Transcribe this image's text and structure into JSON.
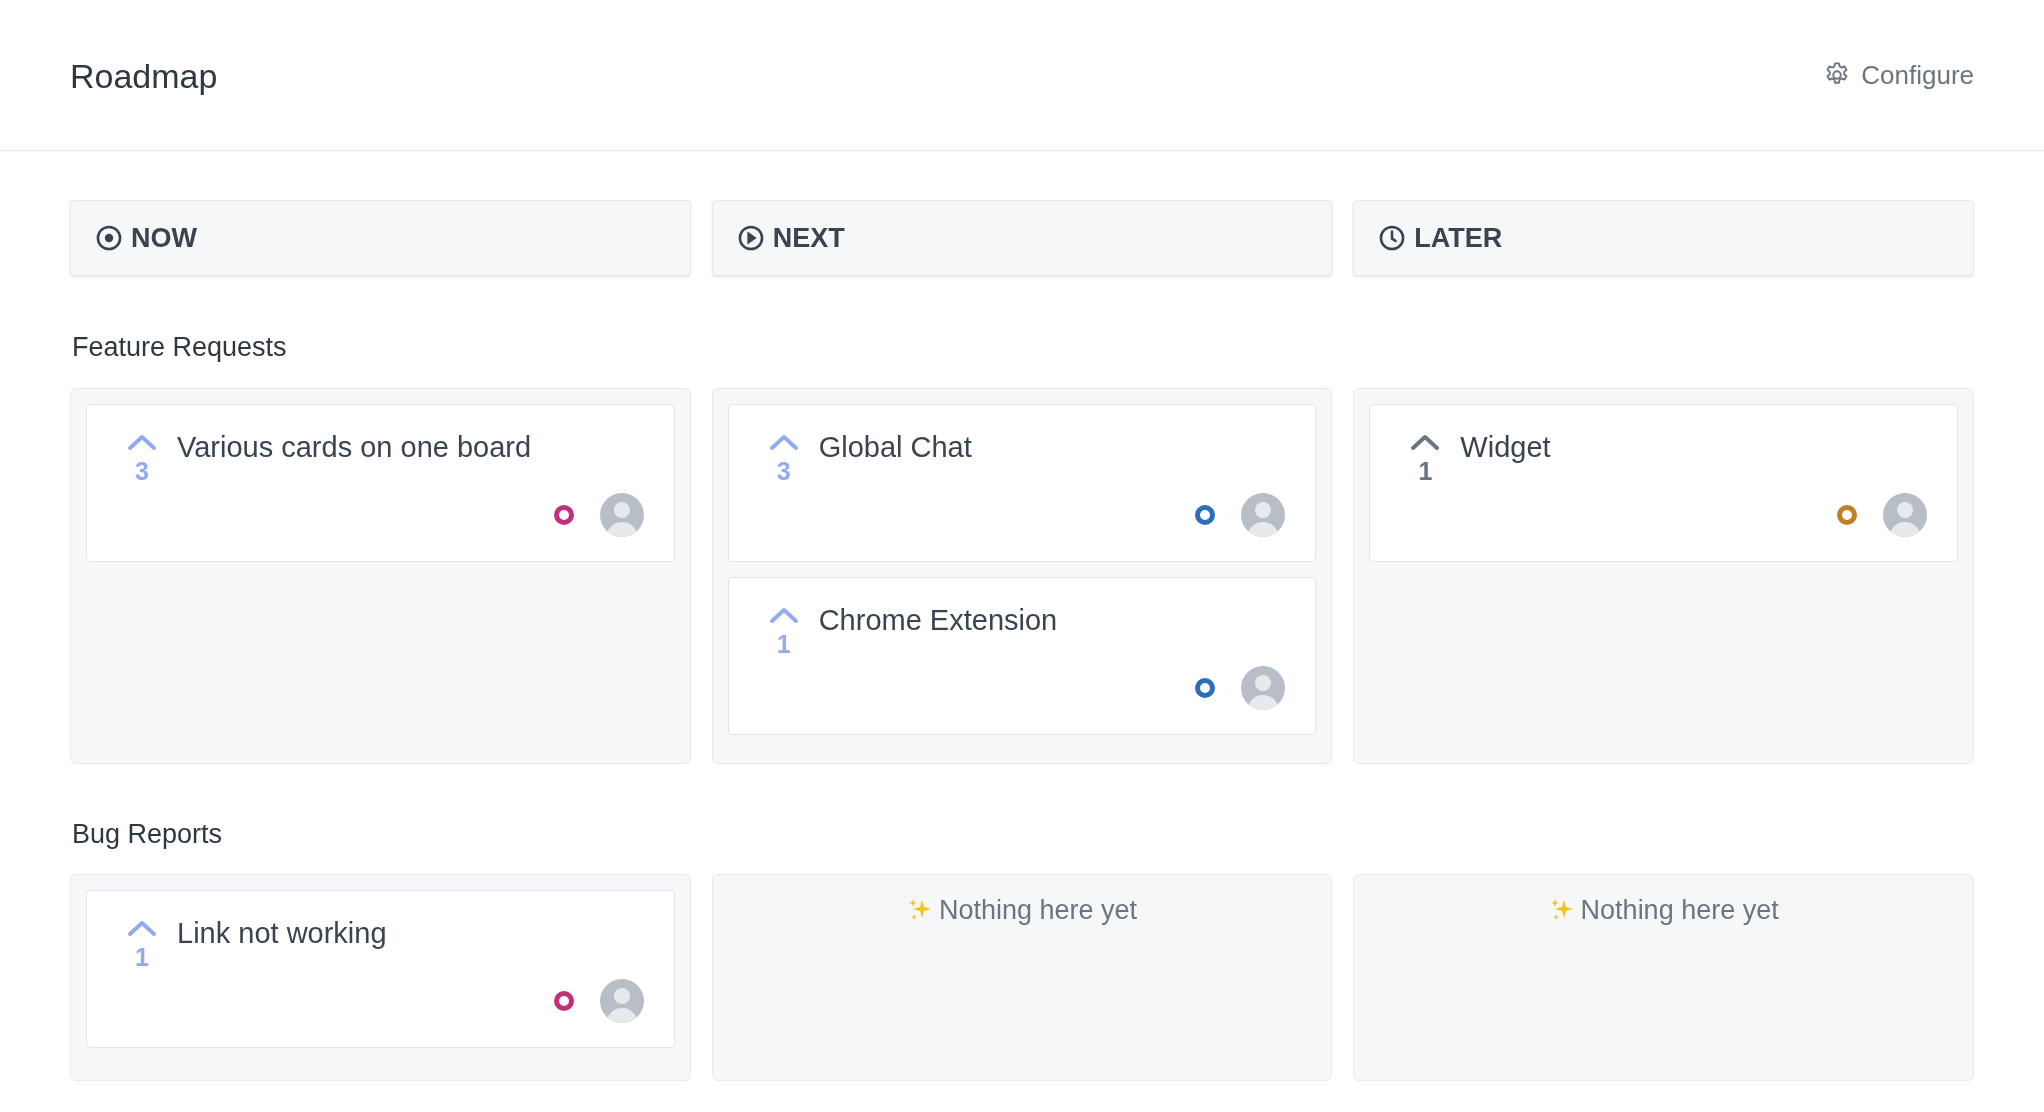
{
  "header": {
    "title": "Roadmap",
    "configure": "Configure"
  },
  "columns": [
    {
      "label": "NOW",
      "kind": "target"
    },
    {
      "label": "NEXT",
      "kind": "play"
    },
    {
      "label": "LATER",
      "kind": "clock"
    }
  ],
  "sections": [
    {
      "title": "Feature Requests",
      "lanes": [
        {
          "cards": [
            {
              "title": "Various cards on one board",
              "votes": "3",
              "voted": true,
              "color": "#c2307a"
            }
          ]
        },
        {
          "cards": [
            {
              "title": "Global Chat",
              "votes": "3",
              "voted": true,
              "color": "#2a6ebd"
            },
            {
              "title": "Chrome Extension",
              "votes": "1",
              "voted": true,
              "color": "#2a6ebd"
            }
          ]
        },
        {
          "cards": [
            {
              "title": "Widget",
              "votes": "1",
              "voted": false,
              "color": "#c27f26"
            }
          ]
        }
      ]
    },
    {
      "title": "Bug Reports",
      "lanes": [
        {
          "cards": [
            {
              "title": "Link not working",
              "votes": "1",
              "voted": true,
              "color": "#c2307a"
            }
          ]
        },
        {
          "empty_text": "Nothing here yet"
        },
        {
          "empty_text": "Nothing here yet"
        }
      ]
    }
  ]
}
